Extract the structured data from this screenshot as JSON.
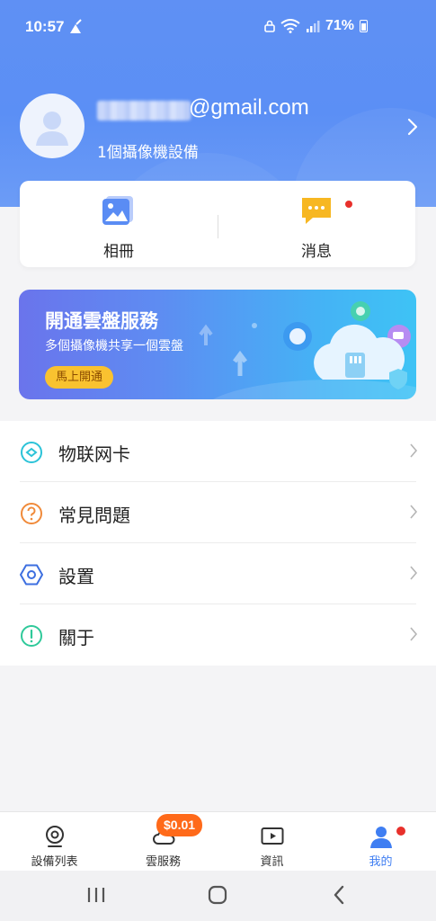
{
  "status_bar": {
    "time": "10:57",
    "battery": "71%"
  },
  "profile": {
    "email_suffix": "@gmail.com",
    "device_count": "1個攝像機設備"
  },
  "quick_actions": [
    {
      "label": "相冊",
      "icon": "album-icon"
    },
    {
      "label": "消息",
      "icon": "message-icon",
      "badge": "red-dot"
    }
  ],
  "banner": {
    "title": "開通雲盤服務",
    "subtitle": "多個攝像機共享一個雲盤",
    "button": "馬上開通"
  },
  "menu": [
    {
      "label": "物联网卡",
      "icon": "iot-card-icon",
      "color": "#2cc3d8"
    },
    {
      "label": "常見問題",
      "icon": "faq-icon",
      "color": "#f08a3a"
    },
    {
      "label": "設置",
      "icon": "settings-icon",
      "color": "#3d6fe0"
    },
    {
      "label": "關于",
      "icon": "about-icon",
      "color": "#2fc99a"
    }
  ],
  "tabbar": {
    "tabs": [
      {
        "label": "設備列表",
        "icon": "camera-icon"
      },
      {
        "label": "雲服務",
        "icon": "cloud-icon",
        "badge": "$0.01"
      },
      {
        "label": "資訊",
        "icon": "video-play-icon"
      },
      {
        "label": "我的",
        "icon": "user-icon",
        "active": true
      }
    ]
  },
  "colors": {
    "header": "#5b8ff5",
    "accent": "#3f7ef2",
    "badge_orange": "#ff6a1a",
    "banner_button": "#f9c230"
  }
}
